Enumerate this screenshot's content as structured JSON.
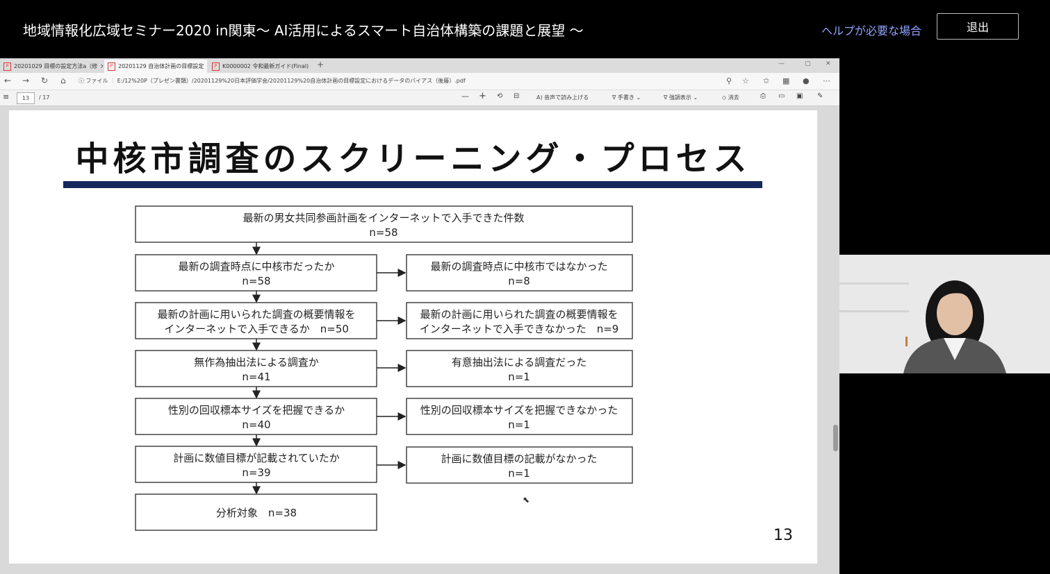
{
  "header": {
    "seminar_title": "地域情報化広域セミナー2020 in関東～ AI活用によるスマート自治体構築の課題と展望 ～",
    "help_link": "ヘルプが必要な場合",
    "exit_label": "退出"
  },
  "browser": {
    "tabs": [
      {
        "label": "20201029 目標の設定方法a（修"
      },
      {
        "label": "20201129 自治体計画の目標設定"
      },
      {
        "label": "K0000002 令和最新ガイド(Final)"
      }
    ],
    "url_prefix": "ファイル",
    "url": "E:/12%20P（プレゼン書類）/20201129%20日本評価学会/20201129%20自治体計画の目標設定におけるデータのバイアス（後藤）.pdf"
  },
  "pdf_toolbar": {
    "page_current": "13",
    "page_total": "/ 17",
    "read_aloud": "音声で読み上げる",
    "draw": "手書き",
    "highlight": "強調表示",
    "erase": "消去"
  },
  "slide": {
    "title": "中核市調査のスクリーニング・プロセス",
    "page_number": "13",
    "flow_top": {
      "line1": "最新の男女共同参画計画をインターネットで入手できた件数",
      "line2": "n=58"
    },
    "flow_steps": [
      {
        "line1": "最新の調査時点に中核市だったか",
        "line2": "n=58",
        "excl1": "最新の調査時点に中核市ではなかった",
        "excl2": "n=8"
      },
      {
        "line1": "最新の計画に用いられた調査の概要情報を",
        "line2": "インターネットで入手できるか　n=50",
        "excl1": "最新の計画に用いられた調査の概要情報を",
        "excl2": "インターネットで入手できなかった　n=9"
      },
      {
        "line1": "無作為抽出法による調査か",
        "line2": "n=41",
        "excl1": "有意抽出法による調査だった",
        "excl2": "n=1"
      },
      {
        "line1": "性別の回収標本サイズを把握できるか",
        "line2": "n=40",
        "excl1": "性別の回収標本サイズを把握できなかった",
        "excl2": "n=1"
      },
      {
        "line1": "計画に数値目標が記載されていたか",
        "line2": "n=39",
        "excl1": "計画に数値目標の記載がなかった",
        "excl2": "n=1"
      }
    ],
    "flow_final": "分析対象　n=38"
  }
}
